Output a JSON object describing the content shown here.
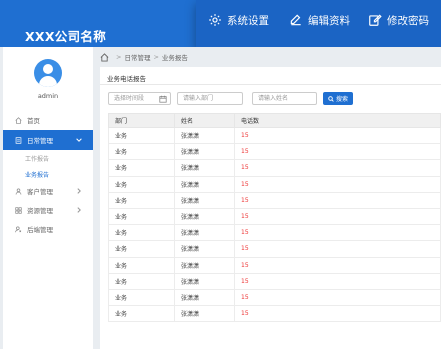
{
  "header": {
    "brand": "XXX公司名称"
  },
  "top_menu": {
    "settings": "系统设置",
    "edit_profile": "编辑资料",
    "change_password": "修改密码"
  },
  "sidebar": {
    "username": "admin",
    "items": [
      {
        "label": "首页",
        "icon": "home-icon"
      },
      {
        "label": "日常管理",
        "icon": "document-icon",
        "active": true
      },
      {
        "label": "客户管理",
        "icon": "user-icon"
      },
      {
        "label": "资源管理",
        "icon": "grid-icon"
      },
      {
        "label": "后端管理",
        "icon": "manage-icon"
      }
    ],
    "sub_items": [
      {
        "label": "工作报告"
      },
      {
        "label": "业务报告",
        "active": true
      }
    ]
  },
  "breadcrumb": {
    "level1": "日常管理",
    "level2": "业务报告"
  },
  "panel": {
    "title": "业务电话报告",
    "filters": {
      "time_placeholder": "选择时间段",
      "dept_placeholder": "请输入部门",
      "name_placeholder": "请输入姓名"
    },
    "search_label": "搜索"
  },
  "table": {
    "headers": [
      "部门",
      "姓名",
      "电话数"
    ],
    "rows": [
      [
        "业务",
        "张潇潇",
        "15"
      ],
      [
        "业务",
        "张潇潇",
        "15"
      ],
      [
        "业务",
        "张潇潇",
        "15"
      ],
      [
        "业务",
        "张潇潇",
        "15"
      ],
      [
        "业务",
        "张潇潇",
        "15"
      ],
      [
        "业务",
        "张潇潇",
        "15"
      ],
      [
        "业务",
        "张潇潇",
        "15"
      ],
      [
        "业务",
        "张潇潇",
        "15"
      ],
      [
        "业务",
        "张潇潇",
        "15"
      ],
      [
        "业务",
        "张潇潇",
        "15"
      ],
      [
        "业务",
        "张潇潇",
        "15"
      ],
      [
        "业务",
        "张潇潇",
        "15"
      ]
    ]
  },
  "colors": {
    "primary": "#1f6fd1",
    "value_red": "#e33333"
  }
}
